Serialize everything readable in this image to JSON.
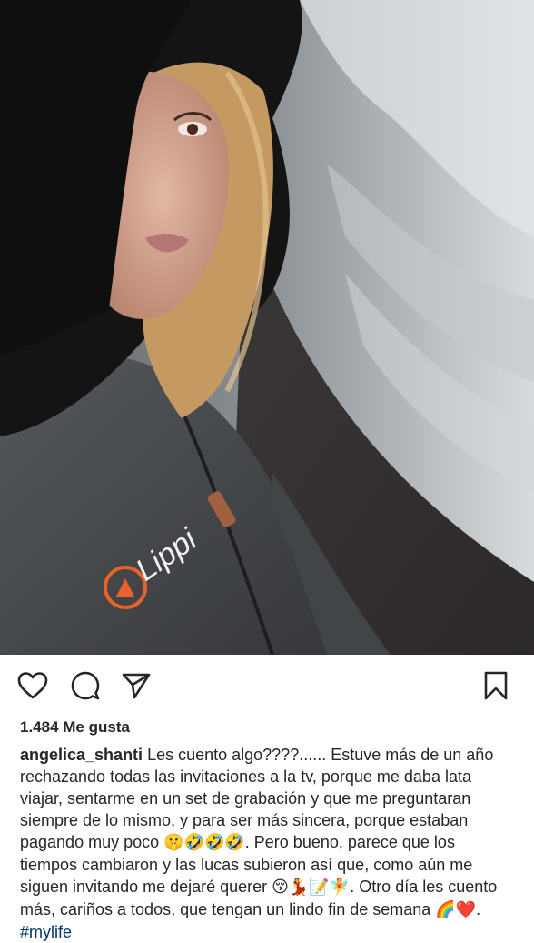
{
  "post": {
    "image_alt": "Selfie de mujer con abrigo gris con capucha de piel negra en la playa",
    "jacket_logo_text": "Lippi"
  },
  "actions": {
    "like_icon": "heart-icon",
    "comment_icon": "comment-bubble-icon",
    "share_icon": "paper-plane-icon",
    "save_icon": "bookmark-icon"
  },
  "likes": {
    "text": "1.484 Me gusta"
  },
  "caption": {
    "username": "angelica_shanti",
    "part1": " Les cuento algo????...... Estuve más de un año rechazando todas las invitaciones a la tv, porque me daba lata viajar, sentarme en un set de grabación y que me preguntaran siempre de lo mismo, y para ser más sincera, porque estaban pagando muy poco ",
    "emoji1": "🤫🤣🤣🤣",
    "part2": ". Pero bueno, parece que los tiempos cambiaron y las lucas subieron así que, como aún me siguen invitando me dejaré querer ",
    "emoji2": "😚💃📝🧚",
    "part3": ". Otro día les cuento más, cariños a todos, que tengan un lindo fin de semana ",
    "emoji3": "🌈❤️",
    "part4": ". ",
    "hashtag": "#mylife"
  },
  "colors": {
    "text": "#262626",
    "hashtag": "#00376b",
    "logo_orange": "#e8622a"
  }
}
